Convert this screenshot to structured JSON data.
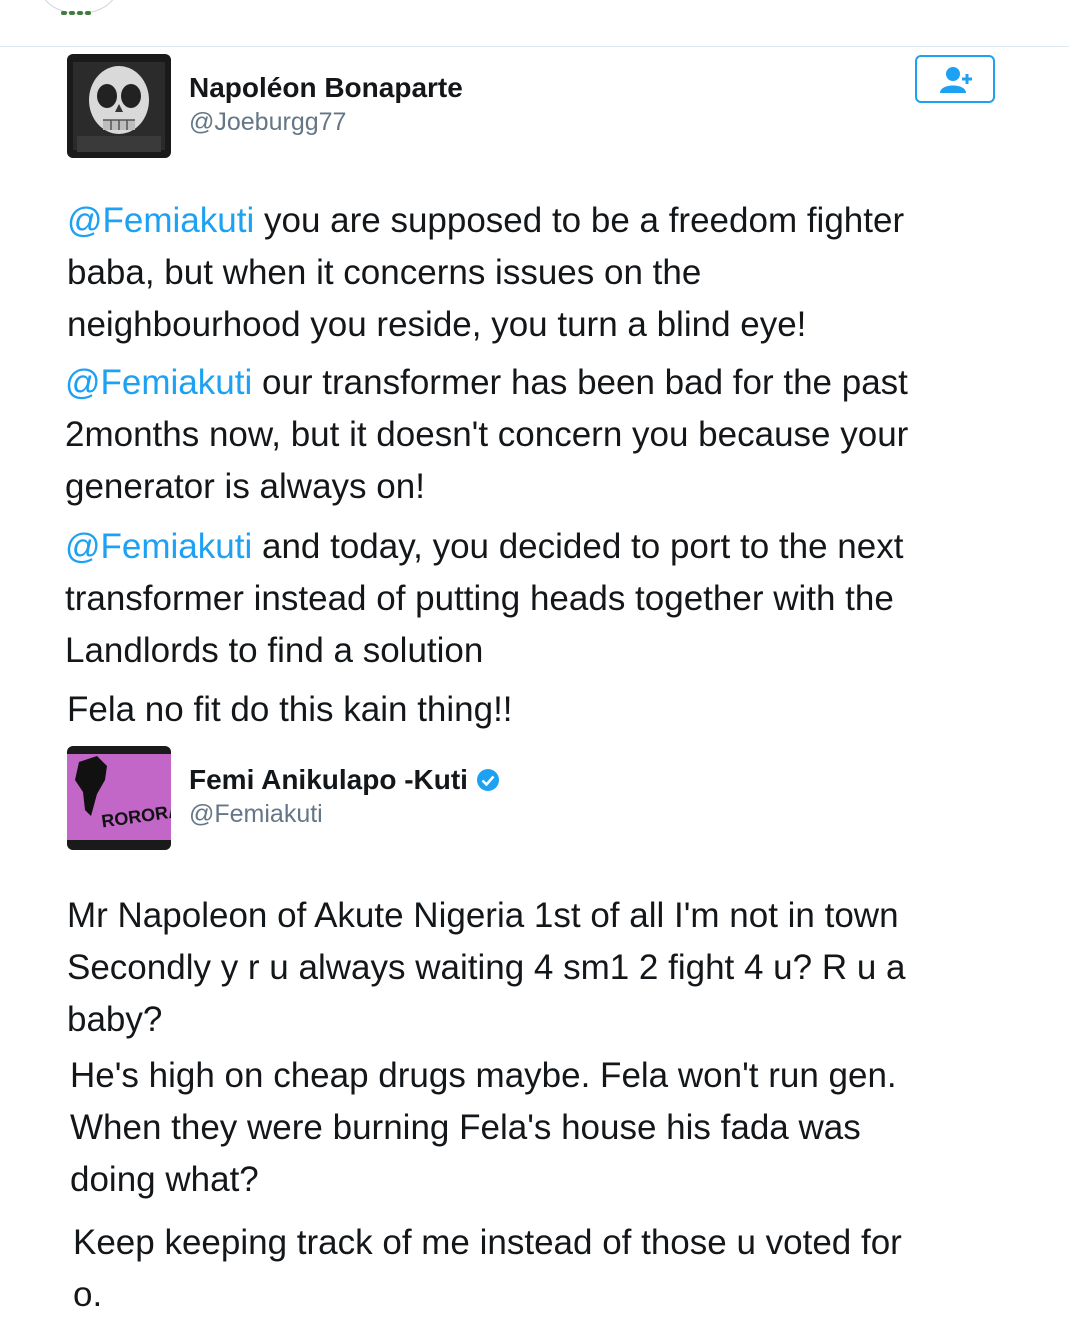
{
  "tweet1": {
    "display_name": "Napoléon Bonaparte",
    "handle": "@Joeburgg77",
    "avatar_icon": "skull-illusion-avatar",
    "follow_icon": "add-user-icon",
    "paragraphs": [
      {
        "mention": "@Femiakuti",
        "lines": [
          " you are supposed to be a freedom fighter",
          "baba, but when it concerns issues on the",
          "neighbourhood you reside, you turn a blind eye!"
        ]
      },
      {
        "mention": "@Femiakuti",
        "lines": [
          " our transformer has been bad for the past",
          "2months now, but it doesn't concern you because your",
          "generator is always on!"
        ]
      },
      {
        "mention": "@Femiakuti",
        "lines": [
          " and today, you decided to port to the next",
          "transformer instead of putting heads together with the",
          "Landlords to find a solution"
        ]
      }
    ],
    "closing": "Fela no fit do this kain thing!!"
  },
  "tweet2": {
    "display_name": "Femi Anikulapo -Kuti",
    "handle": "@Femiakuti",
    "verified_icon": "verified-badge-icon",
    "avatar_text": "RORORARA",
    "paragraphs": [
      {
        "lines": [
          "Mr Napoleon of Akute Nigeria 1st of all I'm not in town",
          "Secondly y r u always waiting 4 sm1 2 fight 4 u? R u a",
          "baby?"
        ]
      },
      {
        "lines": [
          "He's high on cheap drugs maybe. Fela won't run gen.",
          "When they were burning Fela's house his fada was",
          "doing what?"
        ]
      },
      {
        "lines": [
          "Keep keeping track of me instead of those u voted for",
          "o."
        ]
      }
    ]
  },
  "colors": {
    "link": "#1da1f2",
    "text": "#14171a",
    "secondary": "#657786",
    "avatar2_bg": "#c266c8"
  }
}
